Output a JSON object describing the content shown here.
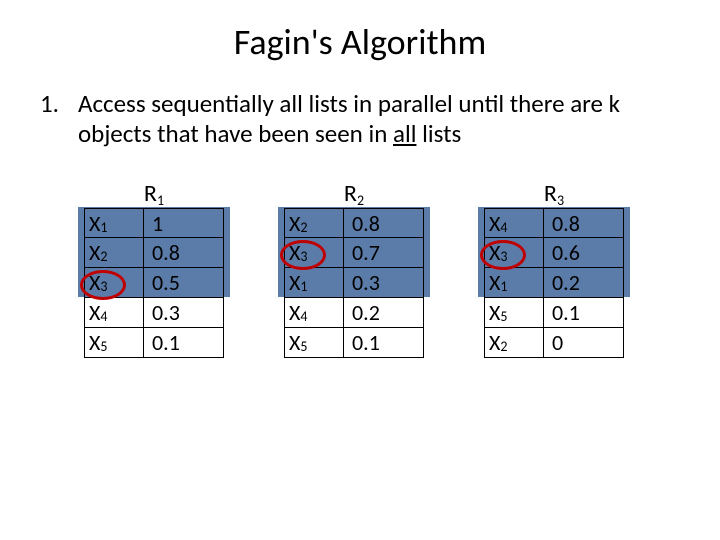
{
  "title": "Fagin's Algorithm",
  "step_number": "1.",
  "body": {
    "prefix": "Access sequentially all lists in parallel until there are ",
    "k": "k",
    "mid": " objects that have been seen in ",
    "all": "all",
    "suffix": " lists"
  },
  "tables": [
    {
      "name": "R1",
      "sub": "1",
      "rows": [
        {
          "x": "X",
          "xs": "1",
          "v": "1",
          "circled": false
        },
        {
          "x": "X",
          "xs": "2",
          "v": "0.8",
          "circled": false
        },
        {
          "x": "X",
          "xs": "3",
          "v": "0.5",
          "circled": true
        },
        {
          "x": "X",
          "xs": "4",
          "v": "0.3",
          "circled": false
        },
        {
          "x": "X",
          "xs": "5",
          "v": "0.1",
          "circled": false
        }
      ]
    },
    {
      "name": "R2",
      "sub": "2",
      "rows": [
        {
          "x": "X",
          "xs": "2",
          "v": "0.8",
          "circled": false
        },
        {
          "x": "X",
          "xs": "3",
          "v": "0.7",
          "circled": true
        },
        {
          "x": "X",
          "xs": "1",
          "v": "0.3",
          "circled": false
        },
        {
          "x": "X",
          "xs": "4",
          "v": "0.2",
          "circled": false
        },
        {
          "x": "X",
          "xs": "5",
          "v": "0.1",
          "circled": false
        }
      ]
    },
    {
      "name": "R3",
      "sub": "3",
      "rows": [
        {
          "x": "X",
          "xs": "4",
          "v": "0.8",
          "circled": false
        },
        {
          "x": "X",
          "xs": "3",
          "v": "0.6",
          "circled": true
        },
        {
          "x": "X",
          "xs": "1",
          "v": "0.2",
          "circled": false
        },
        {
          "x": "X",
          "xs": "5",
          "v": "0.1",
          "circled": false
        },
        {
          "x": "X",
          "xs": "2",
          "v": "0",
          "circled": false
        }
      ]
    }
  ],
  "chart_data": {
    "type": "table",
    "title": "Fagin's Algorithm – ranked lists R1, R2, R3",
    "lists": {
      "R1": [
        [
          "X1",
          1
        ],
        [
          "X2",
          0.8
        ],
        [
          "X3",
          0.5
        ],
        [
          "X4",
          0.3
        ],
        [
          "X5",
          0.1
        ]
      ],
      "R2": [
        [
          "X2",
          0.8
        ],
        [
          "X3",
          0.7
        ],
        [
          "X1",
          0.3
        ],
        [
          "X4",
          0.2
        ],
        [
          "X5",
          0.1
        ]
      ],
      "R3": [
        [
          "X4",
          0.8
        ],
        [
          "X3",
          0.6
        ],
        [
          "X1",
          0.2
        ],
        [
          "X5",
          0.1
        ],
        [
          "X2",
          0
        ]
      ]
    },
    "highlighted_rows": [
      0,
      1,
      2
    ],
    "circled_object": "X3"
  }
}
